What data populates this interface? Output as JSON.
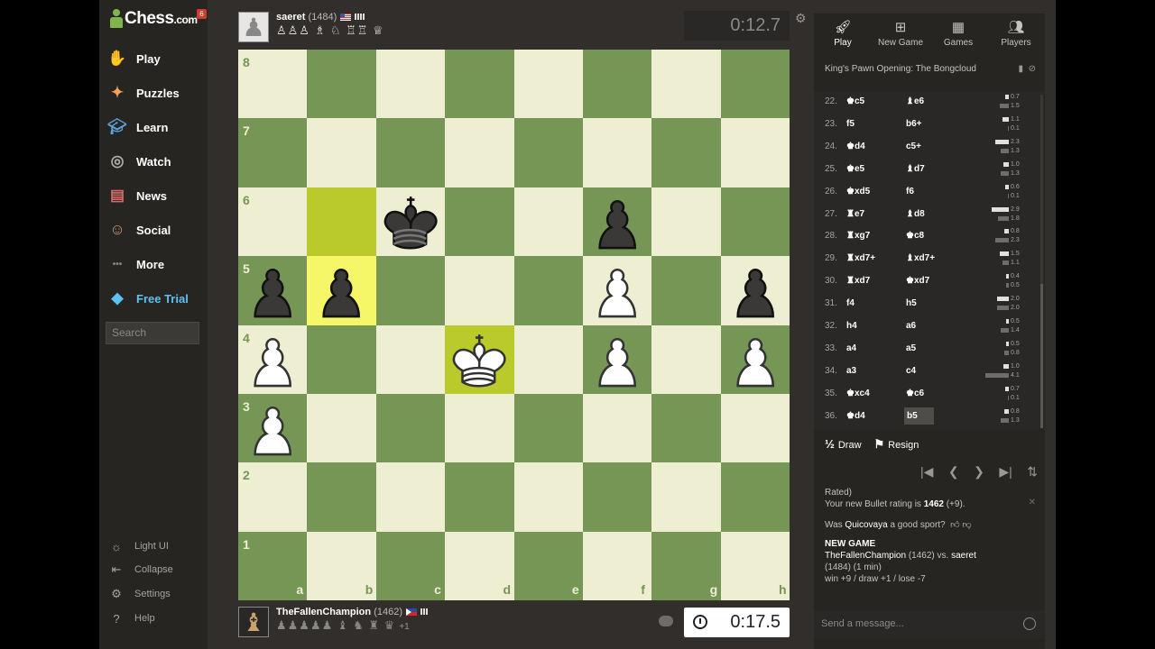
{
  "app": {
    "logo_text": "Chess",
    "logo_suffix": ".com",
    "notification_count": "6"
  },
  "sidebar": {
    "items": [
      {
        "label": "Play",
        "icon": "knight-hand-icon"
      },
      {
        "label": "Puzzles",
        "icon": "puzzle-icon"
      },
      {
        "label": "Learn",
        "icon": "graduation-cap-icon"
      },
      {
        "label": "Watch",
        "icon": "binoculars-icon"
      },
      {
        "label": "News",
        "icon": "newspaper-icon"
      },
      {
        "label": "Social",
        "icon": "people-icon"
      },
      {
        "label": "More",
        "icon": "dots-icon"
      },
      {
        "label": "Free Trial",
        "icon": "diamond-icon"
      }
    ],
    "search_placeholder": "Search",
    "bottom": [
      {
        "label": "Light UI",
        "icon": "sun-icon"
      },
      {
        "label": "Collapse",
        "icon": "collapse-icon"
      },
      {
        "label": "Settings",
        "icon": "gear-icon"
      },
      {
        "label": "Help",
        "icon": "help-icon"
      }
    ]
  },
  "top_player": {
    "name": "saeret",
    "rating": "(1484)",
    "captured": "♙♙♙ ♗ ♘ ♖♖ ♕",
    "clock": "0:12.7"
  },
  "bottom_player": {
    "name": "TheFallenChampion",
    "rating": "(1462)",
    "captured": "♟♟♟♟♟ ♝ ♞ ♜ ♛",
    "material_diff": "+1",
    "clock": "0:17.5"
  },
  "board": {
    "ranks": [
      "8",
      "7",
      "6",
      "5",
      "4",
      "3",
      "2",
      "1"
    ],
    "files": [
      "a",
      "b",
      "c",
      "d",
      "e",
      "f",
      "g",
      "h"
    ],
    "light_color": "#eeeed2",
    "dark_color": "#769656",
    "highlight_from": "b6",
    "highlight_to": "b5",
    "check_square": "d4",
    "pieces": [
      {
        "square": "c6",
        "type": "king",
        "color": "black"
      },
      {
        "square": "f6",
        "type": "pawn",
        "color": "black"
      },
      {
        "square": "a5",
        "type": "pawn",
        "color": "black"
      },
      {
        "square": "b5",
        "type": "pawn",
        "color": "black"
      },
      {
        "square": "f5",
        "type": "pawn",
        "color": "white"
      },
      {
        "square": "h5",
        "type": "pawn",
        "color": "black"
      },
      {
        "square": "a4",
        "type": "pawn",
        "color": "white"
      },
      {
        "square": "d4",
        "type": "king",
        "color": "white"
      },
      {
        "square": "f4",
        "type": "pawn",
        "color": "white"
      },
      {
        "square": "h4",
        "type": "pawn",
        "color": "white"
      },
      {
        "square": "a3",
        "type": "pawn",
        "color": "white"
      }
    ]
  },
  "panel": {
    "tabs": [
      "Play",
      "New Game",
      "Games",
      "Players"
    ],
    "opening": "King's Pawn Opening: The Bongcloud",
    "moves": [
      {
        "n": "22.",
        "w": "♚c5",
        "b": "♝e6",
        "tw": "0.7",
        "tb": "1.5",
        "ww": 4,
        "bw": 10
      },
      {
        "n": "23.",
        "w": "f5",
        "b": "b6+",
        "tw": "1.1",
        "tb": "0.1",
        "ww": 7,
        "bw": 1
      },
      {
        "n": "24.",
        "w": "♚d4",
        "b": "c5+",
        "tw": "2.3",
        "tb": "1.3",
        "ww": 15,
        "bw": 9
      },
      {
        "n": "25.",
        "w": "♚e5",
        "b": "♝d7",
        "tw": "1.0",
        "tb": "1.3",
        "ww": 6,
        "bw": 9
      },
      {
        "n": "26.",
        "w": "♚xd5",
        "b": "f6",
        "tw": "0.6",
        "tb": "0.1",
        "ww": 4,
        "bw": 1
      },
      {
        "n": "27.",
        "w": "♜e7",
        "b": "♝d8",
        "tw": "2.9",
        "tb": "1.8",
        "ww": 19,
        "bw": 12
      },
      {
        "n": "28.",
        "w": "♜xg7",
        "b": "♚c8",
        "tw": "0.8",
        "tb": "2.3",
        "ww": 5,
        "bw": 15
      },
      {
        "n": "29.",
        "w": "♜xd7+",
        "b": "♝xd7+",
        "tw": "1.5",
        "tb": "1.1",
        "ww": 10,
        "bw": 7
      },
      {
        "n": "30.",
        "w": "♜xd7",
        "b": "♚xd7",
        "tw": "0.4",
        "tb": "0.5",
        "ww": 3,
        "bw": 3
      },
      {
        "n": "31.",
        "w": "f4",
        "b": "h5",
        "tw": "2.0",
        "tb": "2.0",
        "ww": 13,
        "bw": 13
      },
      {
        "n": "32.",
        "w": "h4",
        "b": "a6",
        "tw": "0.5",
        "tb": "1.4",
        "ww": 3,
        "bw": 9
      },
      {
        "n": "33.",
        "w": "a4",
        "b": "a5",
        "tw": "0.5",
        "tb": "0.8",
        "ww": 3,
        "bw": 5
      },
      {
        "n": "34.",
        "w": "a3",
        "b": "c4",
        "tw": "1.0",
        "tb": "4.1",
        "ww": 6,
        "bw": 26
      },
      {
        "n": "35.",
        "w": "♚xc4",
        "b": "♚c6",
        "tw": "0.7",
        "tb": "0.1",
        "ww": 4,
        "bw": 1
      },
      {
        "n": "36.",
        "w": "♚d4",
        "b": "b5",
        "tw": "0.8",
        "tb": "1.3",
        "ww": 5,
        "bw": 9
      }
    ],
    "draw_label": "Draw",
    "resign_label": "Resign",
    "chat": {
      "line1": "Rated)",
      "line2_prefix": "Your new Bullet rating is ",
      "line2_rating": "1462",
      "line2_suffix": " (+9).",
      "sport_prefix": "Was ",
      "sport_name": "Quicovaya",
      "sport_suffix": " a good sport?",
      "new_game": "NEW GAME",
      "ng_p1": "TheFallenChampion",
      "ng_p1_rating": " (1462) vs. ",
      "ng_p2": "saeret",
      "ng_line2": "(1484) (1 min)",
      "ng_line3": "win +9 / draw +1 / lose -7"
    },
    "chat_placeholder": "Send a message..."
  }
}
